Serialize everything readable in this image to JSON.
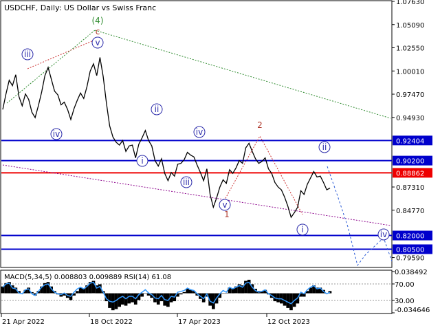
{
  "header": {
    "title": "USDCHF, Daily:  US Dollar vs Swiss Franc"
  },
  "chart_data": {
    "type": "line",
    "symbol": "USDCHF",
    "timeframe": "Daily",
    "x_ticks": [
      "21 Apr 2022",
      "18 Oct 2022",
      "17 Apr 2023",
      "12 Oct 2023"
    ],
    "y_ticks": [
      "1.07630",
      "1.05090",
      "1.02550",
      "1.00010",
      "0.97470",
      "0.94930",
      "0.87310",
      "0.84770",
      "0.79590"
    ],
    "ylim": [
      0.7858,
      1.0763
    ],
    "price_close": [
      0.958,
      0.975,
      0.99,
      0.984,
      0.996,
      0.972,
      0.962,
      0.975,
      0.969,
      0.955,
      0.949,
      0.962,
      0.977,
      0.995,
      1.004,
      0.991,
      0.978,
      0.974,
      0.963,
      0.966,
      0.958,
      0.947,
      0.959,
      0.968,
      0.976,
      0.97,
      0.983,
      1.0,
      1.008,
      0.995,
      1.015,
      0.994,
      0.965,
      0.94,
      0.928,
      0.922,
      0.919,
      0.924,
      0.912,
      0.918,
      0.919,
      0.905,
      0.92,
      0.927,
      0.935,
      0.924,
      0.918,
      0.902,
      0.896,
      0.904,
      0.888,
      0.88,
      0.889,
      0.885,
      0.898,
      0.899,
      0.903,
      0.911,
      0.908,
      0.906,
      0.897,
      0.889,
      0.88,
      0.893,
      0.865,
      0.851,
      0.861,
      0.873,
      0.881,
      0.877,
      0.892,
      0.888,
      0.894,
      0.902,
      0.899,
      0.916,
      0.921,
      0.912,
      0.904,
      0.899,
      0.901,
      0.905,
      0.893,
      0.888,
      0.878,
      0.873,
      0.87,
      0.862,
      0.852,
      0.84,
      0.845,
      0.851,
      0.869,
      0.865,
      0.876,
      0.883,
      0.89,
      0.884,
      0.885,
      0.878,
      0.87,
      0.872
    ],
    "horizontal_levels": [
      {
        "value": "0.92404",
        "color": "#0000cc"
      },
      {
        "value": "0.90200",
        "color": "#0000cc"
      },
      {
        "value": "0.88862",
        "color": "#ee0000"
      },
      {
        "value": "0.82000",
        "color": "#0000cc"
      },
      {
        "value": "0.80500",
        "color": "#0000cc"
      }
    ],
    "wave_labels": [
      {
        "text": "(4)",
        "color": "#2e8b2e",
        "style": "plain"
      },
      {
        "text": "c",
        "color": "#b03a2e",
        "style": "plain"
      },
      {
        "text": "v",
        "color": "#2a2aaa",
        "style": "circled"
      },
      {
        "text": "iii",
        "color": "#2a2aaa",
        "style": "circled"
      },
      {
        "text": "iv",
        "color": "#2a2aaa",
        "style": "circled"
      },
      {
        "text": "ii",
        "color": "#2a2aaa",
        "style": "circled"
      },
      {
        "text": "i",
        "color": "#2a2aaa",
        "style": "circled"
      },
      {
        "text": "iv",
        "color": "#2a2aaa",
        "style": "circled"
      },
      {
        "text": "iii",
        "color": "#2a2aaa",
        "style": "circled"
      },
      {
        "text": "v",
        "color": "#2a2aaa",
        "style": "circled"
      },
      {
        "text": "1",
        "color": "#b03a2e",
        "style": "plain"
      },
      {
        "text": "2",
        "color": "#b03a2e",
        "style": "plain"
      },
      {
        "text": "ii",
        "color": "#2a2aaa",
        "style": "circled"
      },
      {
        "text": "i",
        "color": "#2a2aaa",
        "style": "circled"
      },
      {
        "text": "iv",
        "color": "#2a2aaa",
        "style": "circled"
      }
    ],
    "indicator": {
      "label": "MACD(5,34,5) 0.008803 0.009889 RSI(14) 61.08",
      "y_ticks": [
        "0.038492",
        "70.00",
        "30.00",
        "-0.034646"
      ],
      "macd": [
        0.012,
        0.018,
        0.02,
        0.014,
        0.01,
        0.004,
        0.0,
        0.006,
        0.01,
        0.002,
        -0.004,
        0.004,
        0.012,
        0.018,
        0.02,
        0.012,
        0.004,
        -0.002,
        -0.006,
        -0.004,
        -0.008,
        -0.012,
        -0.004,
        0.004,
        0.01,
        0.008,
        0.014,
        0.02,
        0.022,
        0.014,
        0.016,
        0.004,
        -0.014,
        -0.026,
        -0.03,
        -0.028,
        -0.024,
        -0.02,
        -0.022,
        -0.018,
        -0.016,
        -0.02,
        -0.012,
        -0.006,
        0.0,
        -0.004,
        -0.008,
        -0.016,
        -0.02,
        -0.014,
        -0.022,
        -0.024,
        -0.016,
        -0.014,
        -0.006,
        -0.002,
        0.002,
        0.008,
        0.006,
        0.004,
        -0.004,
        -0.01,
        -0.016,
        -0.006,
        -0.022,
        -0.028,
        -0.018,
        -0.008,
        0.0,
        0.0,
        0.01,
        0.008,
        0.012,
        0.016,
        0.014,
        0.022,
        0.024,
        0.016,
        0.008,
        0.004,
        0.004,
        0.006,
        -0.002,
        -0.008,
        -0.014,
        -0.016,
        -0.018,
        -0.022,
        -0.026,
        -0.03,
        -0.024,
        -0.018,
        -0.006,
        -0.006,
        0.004,
        0.01,
        0.014,
        0.01,
        0.01,
        0.006,
        0.0,
        0.004
      ],
      "rsi": [
        62,
        70,
        72,
        60,
        58,
        48,
        46,
        56,
        58,
        46,
        42,
        52,
        62,
        68,
        70,
        58,
        50,
        46,
        44,
        48,
        42,
        40,
        50,
        58,
        62,
        58,
        64,
        72,
        74,
        60,
        64,
        50,
        34,
        28,
        26,
        30,
        36,
        40,
        34,
        40,
        40,
        34,
        44,
        50,
        56,
        48,
        44,
        36,
        34,
        42,
        32,
        30,
        40,
        38,
        50,
        52,
        54,
        60,
        56,
        54,
        46,
        40,
        34,
        46,
        28,
        24,
        36,
        46,
        54,
        50,
        62,
        58,
        62,
        66,
        62,
        72,
        74,
        62,
        54,
        50,
        52,
        56,
        46,
        42,
        36,
        34,
        34,
        30,
        26,
        22,
        30,
        36,
        50,
        46,
        56,
        62,
        66,
        58,
        60,
        52,
        46,
        50
      ],
      "rsi_color": "#3399ff",
      "macd_color": "#000000"
    }
  }
}
